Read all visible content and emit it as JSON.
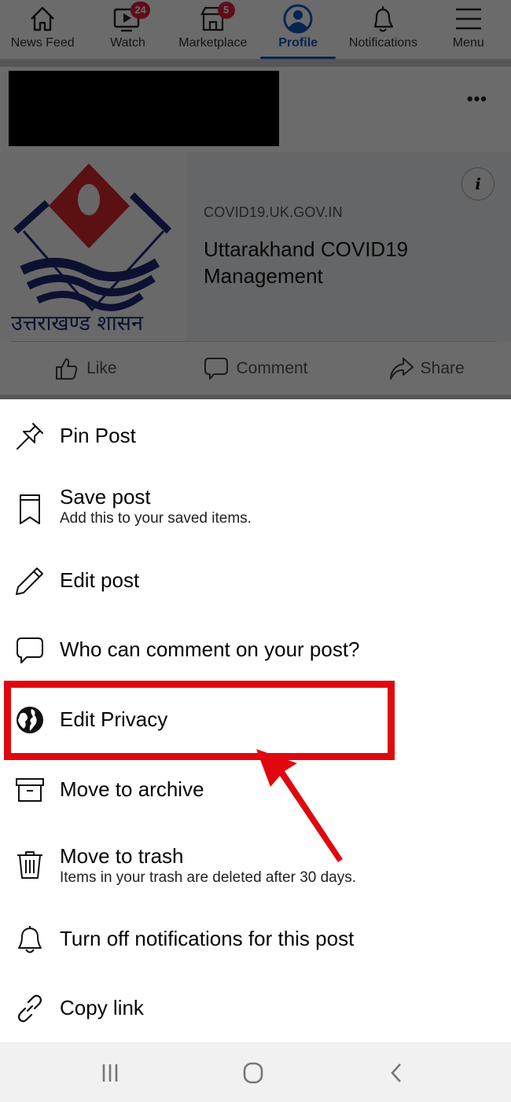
{
  "top_nav": {
    "items": [
      {
        "label": "News Feed",
        "icon": "home-icon",
        "badge": null,
        "active": false
      },
      {
        "label": "Watch",
        "icon": "video-icon",
        "badge": "24",
        "active": false
      },
      {
        "label": "Marketplace",
        "icon": "store-icon",
        "badge": "5",
        "active": false
      },
      {
        "label": "Profile",
        "icon": "profile-icon",
        "badge": null,
        "active": true
      },
      {
        "label": "Notifications",
        "icon": "bell-icon",
        "badge": null,
        "active": false
      },
      {
        "label": "Menu",
        "icon": "hamburger-icon",
        "badge": null,
        "active": false
      }
    ]
  },
  "post": {
    "more_icon": "more-options-icon",
    "link_card": {
      "domain": "COVID19.UK.GOV.IN",
      "title": "Uttarakhand COVID19 Management",
      "thumbnail_caption": "उत्तराखण्ड शासन",
      "info_icon": "i"
    },
    "actions": [
      {
        "label": "Like",
        "icon": "like-icon"
      },
      {
        "label": "Comment",
        "icon": "comment-icon"
      },
      {
        "label": "Share",
        "icon": "share-icon"
      }
    ]
  },
  "sheet": {
    "items": [
      {
        "label": "Pin Post",
        "sub": "",
        "icon": "pin-icon"
      },
      {
        "label": "Save post",
        "sub": "Add this to your saved items.",
        "icon": "bookmark-icon"
      },
      {
        "label": "Edit post",
        "sub": "",
        "icon": "pencil-icon"
      },
      {
        "label": "Who can comment on your post?",
        "sub": "",
        "icon": "comment-bubble-icon"
      },
      {
        "label": "Edit Privacy",
        "sub": "",
        "icon": "globe-icon",
        "highlighted": true
      },
      {
        "label": "Move to archive",
        "sub": "",
        "icon": "archive-icon"
      },
      {
        "label": "Move to trash",
        "sub": "Items in your trash are deleted after 30 days.",
        "icon": "trash-icon"
      },
      {
        "label": "Turn off notifications for this post",
        "sub": "",
        "icon": "bell-icon"
      },
      {
        "label": "Copy link",
        "sub": "",
        "icon": "link-icon"
      }
    ]
  },
  "annotation": {
    "highlight_color": "#e0080f",
    "target": "Edit Privacy"
  },
  "system_nav": {
    "buttons": [
      "recent-apps",
      "home",
      "back"
    ]
  },
  "colors": {
    "accent": "#1458c4",
    "badge": "#e41e3f",
    "overlay": "rgba(0,0,0,0.58)"
  }
}
